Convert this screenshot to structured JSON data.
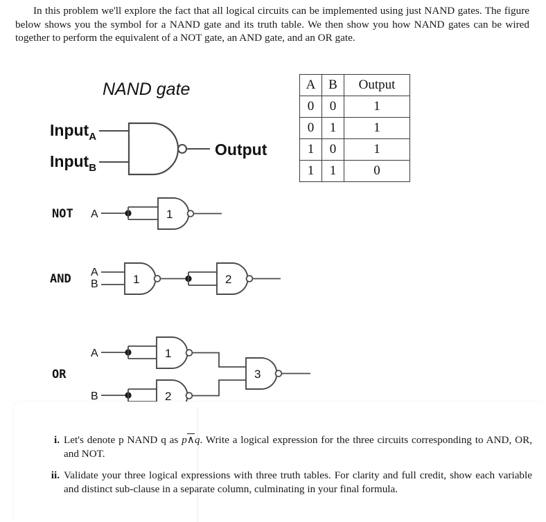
{
  "intro": {
    "paragraph": "In this problem we'll explore the fact that all logical circuits can be implemented using just NAND gates. The figure below shows you the symbol for a NAND gate and its truth table. We then show you how NAND gates can be wired together to perform the equivalent of a NOT gate, an AND gate, and an OR gate."
  },
  "figure": {
    "title": "NAND gate",
    "nand_symbol": {
      "input_a_label": "Input",
      "input_a_sub": "A",
      "input_b_label": "Input",
      "input_b_sub": "B",
      "output_label": "Output"
    },
    "circuits": [
      {
        "name": "NOT",
        "label": "NOT",
        "inputs": [
          "A"
        ],
        "gate_numbers": [
          "1"
        ]
      },
      {
        "name": "AND",
        "label": "AND",
        "inputs": [
          "A",
          "B"
        ],
        "gate_numbers": [
          "1",
          "2"
        ]
      },
      {
        "name": "OR",
        "label": "OR",
        "inputs": [
          "A",
          "B"
        ],
        "gate_numbers": [
          "1",
          "2",
          "3"
        ]
      }
    ]
  },
  "truth_table": {
    "headers": [
      "A",
      "B",
      "Output"
    ],
    "rows": [
      [
        "0",
        "0",
        "1"
      ],
      [
        "0",
        "1",
        "1"
      ],
      [
        "1",
        "0",
        "1"
      ],
      [
        "1",
        "1",
        "0"
      ]
    ]
  },
  "questions": [
    {
      "marker": "i.",
      "text_before": "Let's denote p NAND q as ",
      "expr_p": "p",
      "expr_op": "∧",
      "expr_q": "q",
      "text_after": ". Write a logical expression for the three circuits corresponding to AND, OR, and NOT."
    },
    {
      "marker": "ii.",
      "text": "Validate your three logical expressions with three truth tables. For clarity and full credit, show each variable and distinct sub-clause in a separate column, culminating in your final formula."
    }
  ],
  "colors": {
    "ink": "#181818",
    "wire": "#4a4a4a",
    "table_border": "#3a3a3a",
    "background": "#ffffff"
  }
}
